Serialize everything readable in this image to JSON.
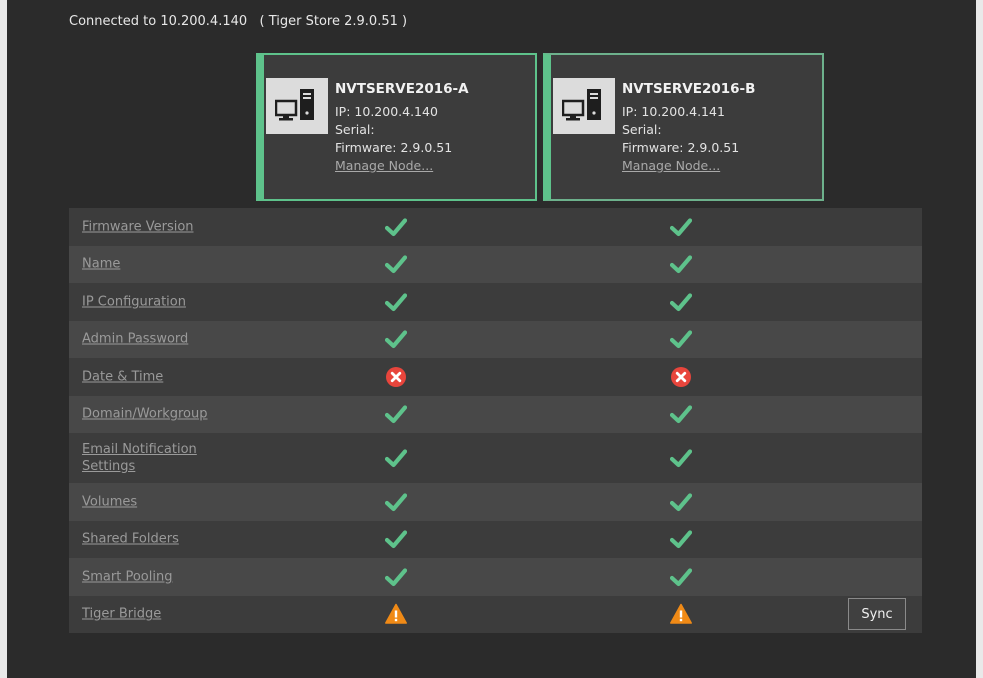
{
  "header": {
    "connected_text": "Connected to 10.200.4.140   ( Tiger Store 2.9.0.51 )"
  },
  "nodes": [
    {
      "hostname": "NVTSERVE2016-A",
      "ip": "IP: 10.200.4.140",
      "serial": "Serial:",
      "firmware": "Firmware: 2.9.0.51",
      "manage_link": "Manage Node..."
    },
    {
      "hostname": "NVTSERVE2016-B",
      "ip": "IP: 10.200.4.141",
      "serial": "Serial:",
      "firmware": "Firmware: 2.9.0.51",
      "manage_link": "Manage Node..."
    }
  ],
  "rows": [
    {
      "label": "Firmware Version",
      "status_a": "check",
      "status_b": "check"
    },
    {
      "label": "Name",
      "status_a": "check",
      "status_b": "check"
    },
    {
      "label": "IP Configuration",
      "status_a": "check",
      "status_b": "check"
    },
    {
      "label": "Admin Password",
      "status_a": "check",
      "status_b": "check"
    },
    {
      "label": "Date & Time",
      "status_a": "error",
      "status_b": "error"
    },
    {
      "label": "Domain/Workgroup",
      "status_a": "check",
      "status_b": "check"
    },
    {
      "label": "Email Notification Settings",
      "status_a": "check",
      "status_b": "check"
    },
    {
      "label": "Volumes",
      "status_a": "check",
      "status_b": "check"
    },
    {
      "label": "Shared Folders",
      "status_a": "check",
      "status_b": "check"
    },
    {
      "label": "Smart Pooling",
      "status_a": "check",
      "status_b": "check"
    },
    {
      "label": "Tiger Bridge",
      "status_a": "warning",
      "status_b": "warning"
    }
  ],
  "sync_label": "Sync",
  "colors": {
    "check": "#5ec28b",
    "error": "#e8453c",
    "warning": "#f08a16",
    "card_border": "#5ec28b"
  }
}
